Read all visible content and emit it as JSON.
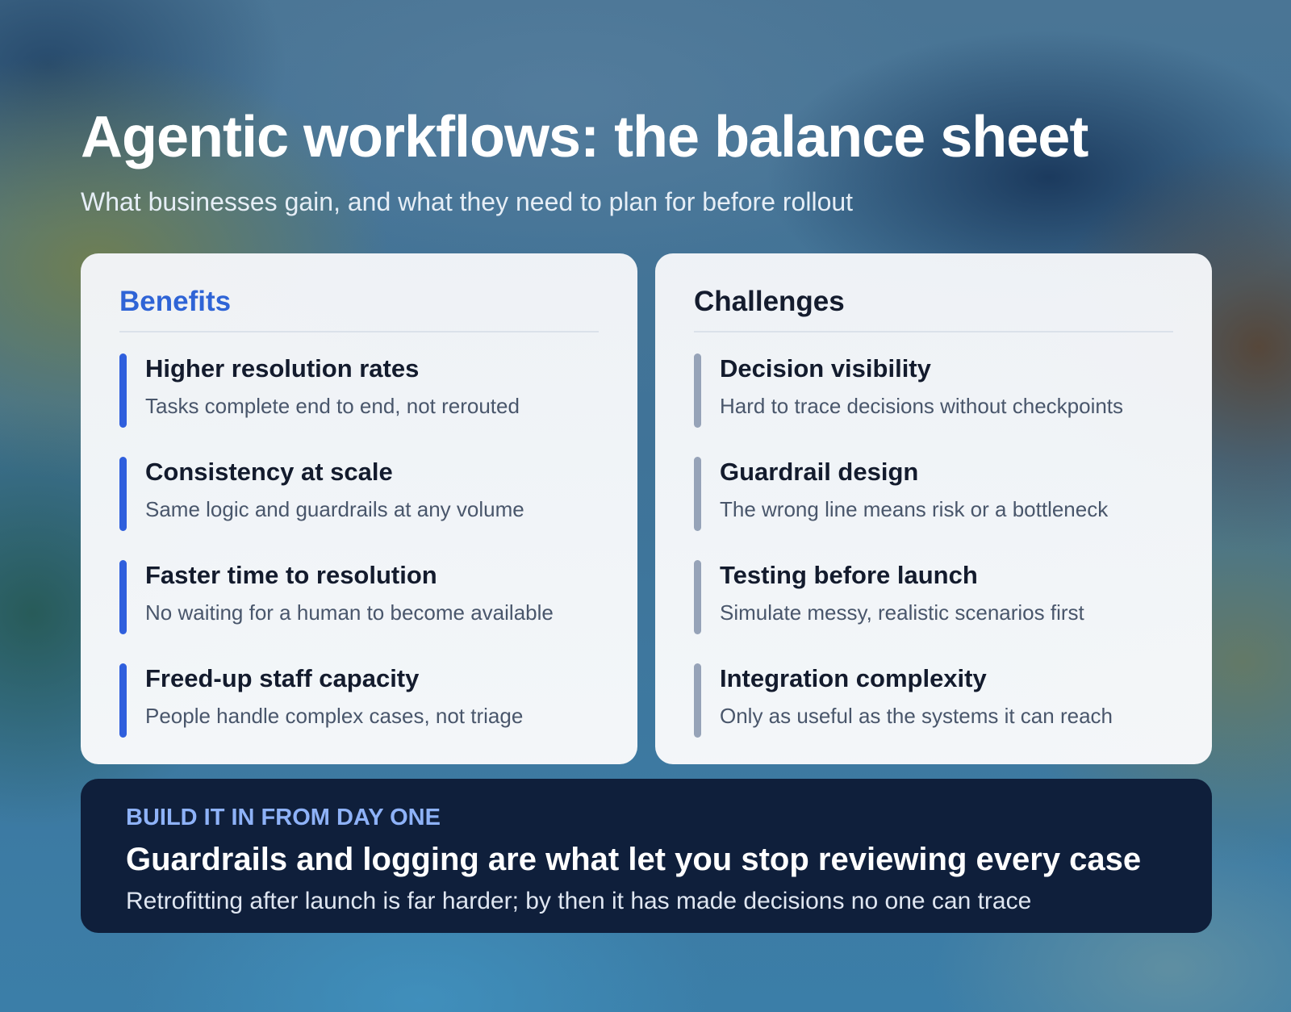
{
  "header": {
    "title": "Agentic workflows: the balance sheet",
    "subtitle": "What businesses gain, and what they need to plan for before rollout"
  },
  "benefits": {
    "heading": "Benefits",
    "accent_color": "#2f5fdd",
    "items": [
      {
        "title": "Higher resolution rates",
        "description": "Tasks complete end to end, not rerouted"
      },
      {
        "title": "Consistency at scale",
        "description": "Same logic and guardrails at any volume"
      },
      {
        "title": "Faster time to resolution",
        "description": "No waiting for a human to become available"
      },
      {
        "title": "Freed-up staff capacity",
        "description": "People handle complex cases, not triage"
      }
    ]
  },
  "challenges": {
    "heading": "Challenges",
    "accent_color": "#96a3b8",
    "items": [
      {
        "title": "Decision visibility",
        "description": "Hard to trace decisions without checkpoints"
      },
      {
        "title": "Guardrail design",
        "description": "The wrong line means risk or a bottleneck"
      },
      {
        "title": "Testing before launch",
        "description": "Simulate messy, realistic scenarios first"
      },
      {
        "title": "Integration complexity",
        "description": "Only as useful as the systems it can reach"
      }
    ]
  },
  "callout": {
    "eyebrow": "BUILD IT IN FROM DAY ONE",
    "title": "Guardrails and logging are what let you stop reviewing every case",
    "description": "Retrofitting after launch is far harder; by then it has made decisions no one can trace",
    "background_color": "#0f1f3b"
  }
}
